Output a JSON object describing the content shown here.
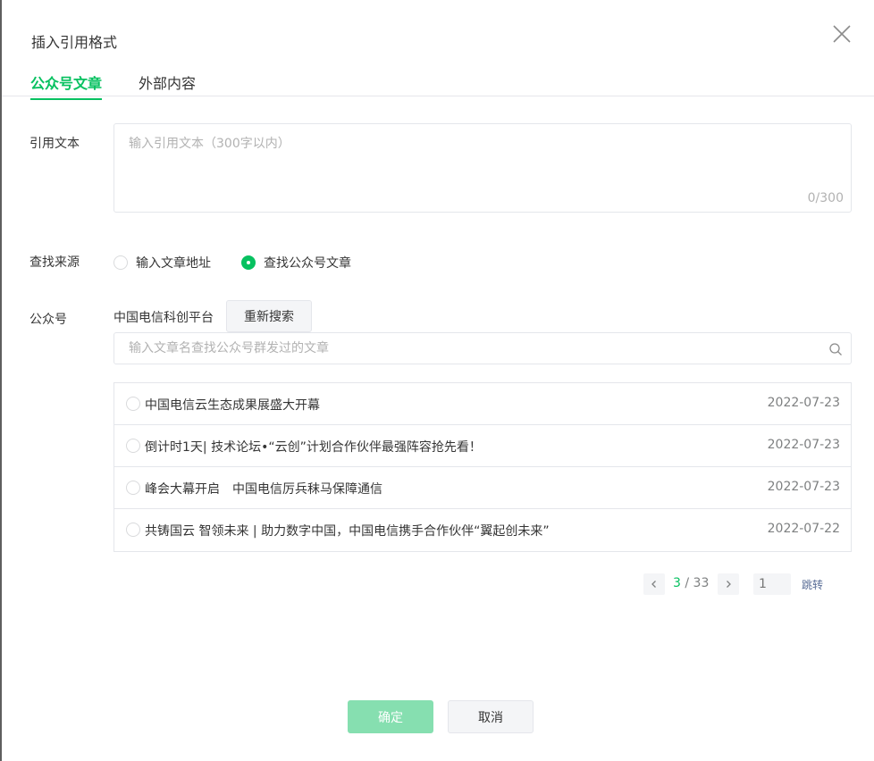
{
  "dialog": {
    "title": "插入引用格式",
    "tabs": [
      {
        "label": "公众号文章",
        "active": true
      },
      {
        "label": "外部内容",
        "active": false
      }
    ]
  },
  "quote": {
    "label": "引用文本",
    "placeholder": "输入引用文本（300字以内）",
    "value": "",
    "counter": "0/300"
  },
  "source": {
    "label": "查找来源",
    "options": [
      {
        "label": "输入文章地址",
        "checked": false
      },
      {
        "label": "查找公众号文章",
        "checked": true
      }
    ]
  },
  "account": {
    "label": "公众号",
    "name": "中国电信科创平台",
    "research_label": "重新搜索",
    "search_placeholder": "输入文章名查找公众号群发过的文章"
  },
  "articles": [
    {
      "title": "中国电信云生态成果展盛大开幕",
      "date": "2022-07-23"
    },
    {
      "title": "倒计时1天| 技术论坛•“云创”计划合作伙伴最强阵容抢先看！",
      "date": "2022-07-23"
    },
    {
      "title": "峰会大幕开启　中国电信厉兵秣马保障通信",
      "date": "2022-07-23"
    },
    {
      "title": "共铸国云 智领未来 | 助力数字中国，中国电信携手合作伙伴“翼起创未来”",
      "date": "2022-07-22"
    }
  ],
  "pagination": {
    "current": "3",
    "separator": " / ",
    "total": "33",
    "jump_placeholder": "1",
    "jump_label": "跳转"
  },
  "footer": {
    "confirm_label": "确定",
    "cancel_label": "取消"
  },
  "colors": {
    "accent": "#07c160",
    "confirm_disabled": "#86dfb0",
    "link": "#576b95"
  }
}
